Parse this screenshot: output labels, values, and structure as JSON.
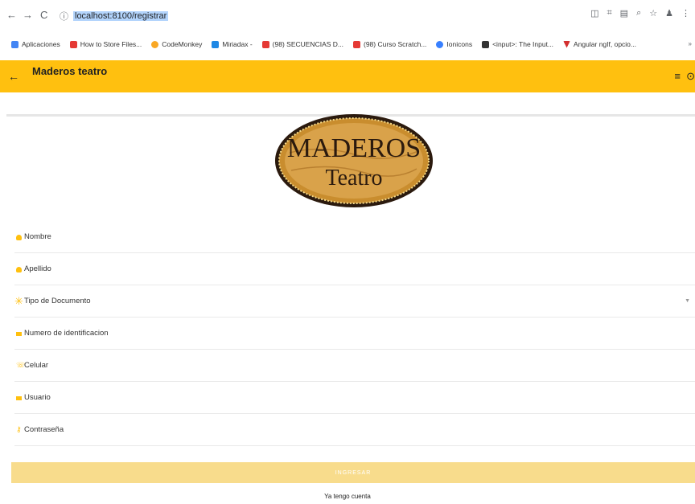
{
  "browser": {
    "url": "localhost:8100/registrar",
    "bookmarks": [
      {
        "label": "Aplicaciones",
        "color": "#4285f4"
      },
      {
        "label": "How to Store Files...",
        "color": "#e53935"
      },
      {
        "label": "CodeMonkey",
        "color": "#f9a825"
      },
      {
        "label": "Miriadax -",
        "color": "#1e88e5"
      },
      {
        "label": "(98) SECUENCIAS D...",
        "color": "#e53935"
      },
      {
        "label": "(98) Curso Scratch...",
        "color": "#e53935"
      },
      {
        "label": "Ionicons",
        "color": "#3880ff"
      },
      {
        "label": "<input>: The Input...",
        "color": "#333333"
      },
      {
        "label": "Angular ngIf, opcio...",
        "color": "#d32f2f"
      }
    ],
    "more": "»"
  },
  "header": {
    "title": "Maderos teatro",
    "background": "#ffc00f"
  },
  "logo": {
    "line1": "MADEROS",
    "line2": "Teatro"
  },
  "form": {
    "fields": [
      {
        "label": "Nombre",
        "icon": "person-icon"
      },
      {
        "label": "Apellido",
        "icon": "person-icon"
      },
      {
        "label": "Tipo de Documento",
        "icon": "asterisk-icon"
      },
      {
        "label": "Numero de identificacion",
        "icon": "card-icon"
      },
      {
        "label": "Celular",
        "icon": "phone-icon"
      },
      {
        "label": "Usuario",
        "icon": "card-icon"
      },
      {
        "label": "Contraseña",
        "icon": "key-icon"
      }
    ],
    "submit_label": "INGRESAR",
    "login_link": "Ya tengo cuenta"
  }
}
